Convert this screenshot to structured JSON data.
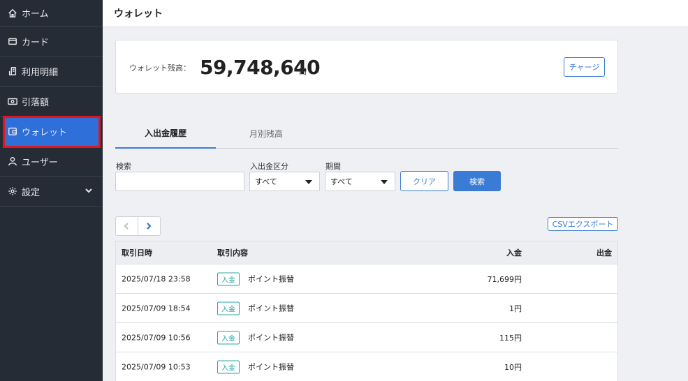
{
  "sidebar": {
    "items": [
      {
        "label": "ホーム",
        "icon": "home-icon"
      },
      {
        "label": "カード",
        "icon": "card-icon"
      },
      {
        "label": "利用明細",
        "icon": "receipt-icon"
      },
      {
        "label": "引落額",
        "icon": "banknote-icon"
      },
      {
        "label": "ウォレット",
        "icon": "wallet-icon",
        "active": true
      },
      {
        "label": "ユーザー",
        "icon": "user-icon"
      },
      {
        "label": "設定",
        "icon": "gear-icon"
      }
    ]
  },
  "header": {
    "title": "ウォレット"
  },
  "balance": {
    "label": "ウォレット残高：",
    "value": "59,748,640",
    "unit": "円",
    "charge_label": "チャージ"
  },
  "tabs": [
    {
      "label": "入出金履歴",
      "active": true
    },
    {
      "label": "月別残高",
      "active": false
    }
  ],
  "filters": {
    "search_label": "検索",
    "search_value": "",
    "type_label": "入出金区分",
    "type_value": "すべて",
    "period_label": "期間",
    "period_value": "すべて",
    "clear_label": "クリア",
    "search_button_label": "検索"
  },
  "csv_label": "CSVエクスポート",
  "table": {
    "headers": {
      "date": "取引日時",
      "content": "取引内容",
      "in": "入金",
      "out": "出金"
    },
    "rows": [
      {
        "date": "2025/07/18 23:58",
        "badge": "入金",
        "content": "ポイント振替",
        "in": "71,699円",
        "out": ""
      },
      {
        "date": "2025/07/09 18:54",
        "badge": "入金",
        "content": "ポイント振替",
        "in": "1円",
        "out": ""
      },
      {
        "date": "2025/07/09 10:56",
        "badge": "入金",
        "content": "ポイント振替",
        "in": "115円",
        "out": ""
      },
      {
        "date": "2025/07/09 10:53",
        "badge": "入金",
        "content": "ポイント振替",
        "in": "10円",
        "out": ""
      }
    ]
  },
  "colors": {
    "sidebar_bg": "#262c36",
    "accent": "#3a7bd5",
    "active_nav": "#2e6fd9",
    "highlight": "#e3141b",
    "badge": "#2aa6a6"
  }
}
